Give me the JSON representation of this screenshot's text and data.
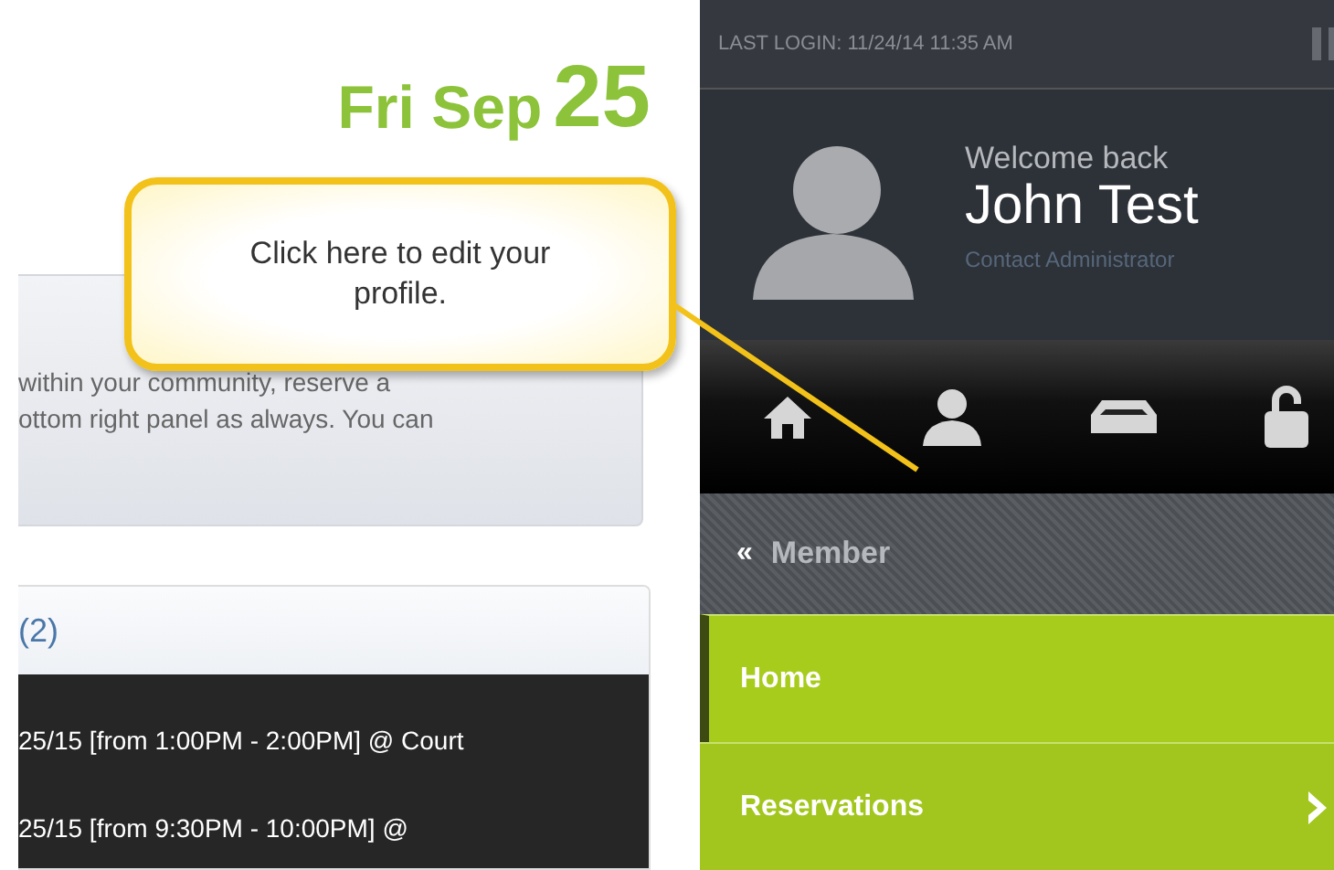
{
  "date": {
    "weekday_month": "Fri Sep",
    "day": "25"
  },
  "callout": {
    "text": "Click here to edit your profile."
  },
  "notice": {
    "lines": [
      "within your community, reserve a",
      "ottom right panel as always. You can"
    ]
  },
  "reservations": {
    "count": "(2)",
    "rows": [
      "25/15 [from 1:00PM - 2:00PM] @ Court",
      "25/15 [from 9:30PM - 10:00PM] @"
    ]
  },
  "sidebar": {
    "last_login": "LAST LOGIN: 11/24/14 11:35 AM",
    "welcome": "Welcome back",
    "user_name": "John Test",
    "contact_link": "Contact Administrator",
    "toolbar": [
      {
        "kind": "home"
      },
      {
        "kind": "profile"
      },
      {
        "kind": "inbox"
      },
      {
        "kind": "lock"
      }
    ],
    "section": {
      "back": "«",
      "title": "Member"
    },
    "menu": [
      {
        "label": "Home",
        "selected": true,
        "has_submenu": false
      },
      {
        "label": "Reservations",
        "selected": false,
        "has_submenu": true
      }
    ]
  }
}
